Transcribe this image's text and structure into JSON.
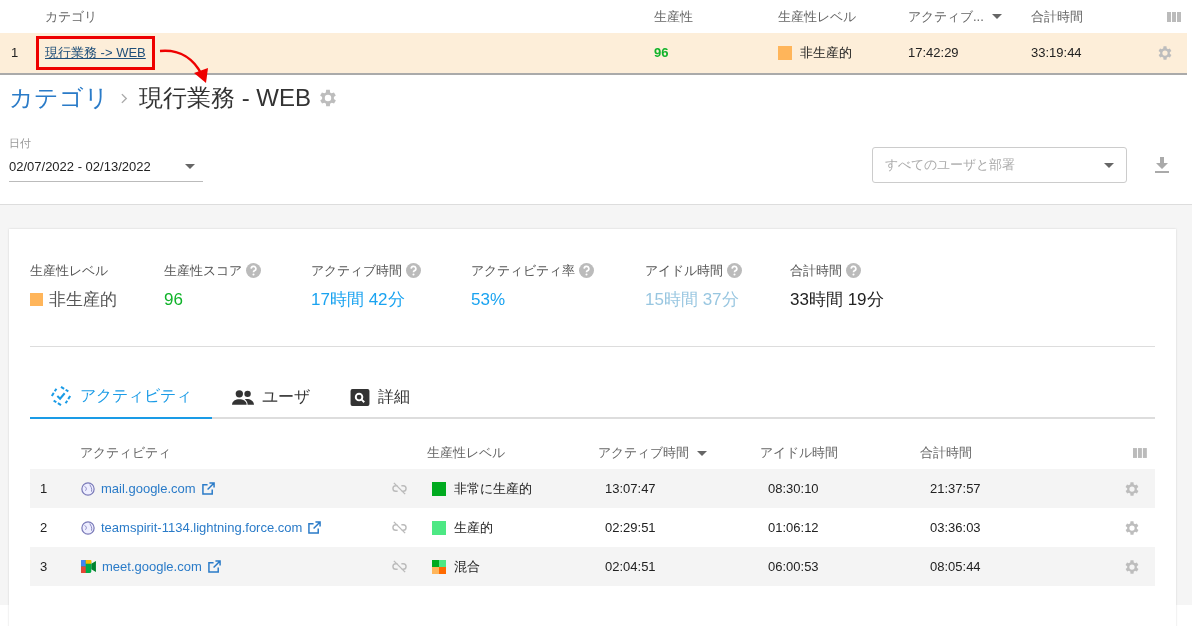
{
  "category_table": {
    "columns": [
      {
        "label": "カテゴリ",
        "sorted": false
      },
      {
        "label": "生産性",
        "sorted": false
      },
      {
        "label": "生産性レベル",
        "sorted": false
      },
      {
        "label": "アクティブ...",
        "sorted": true
      },
      {
        "label": "合計時間",
        "sorted": false
      }
    ],
    "rows": [
      {
        "index": "1",
        "category": "現行業務 -> WEB",
        "highlighted": true,
        "score": "96",
        "level": {
          "label": "非生産的",
          "kind": "solid",
          "color": "#ffb55a"
        },
        "active": "17:42:29",
        "total": "33:19:44"
      }
    ]
  },
  "breadcrumb": {
    "root": "カテゴリ",
    "current": "現行業務 - WEB"
  },
  "date_filter": {
    "label": "日付",
    "value": "02/07/2022 - 02/13/2022"
  },
  "user_filter": {
    "placeholder": "すべてのユーザと部署"
  },
  "stats": [
    {
      "label": "生産性レベル",
      "value": "非生産的",
      "kind": "level",
      "color": "#ffb55a",
      "help": false
    },
    {
      "label": "生産性スコア",
      "value": "96",
      "kind": "score",
      "help": true
    },
    {
      "label": "アクティブ時間",
      "value": "17時間 42分",
      "kind": "accent",
      "help": true
    },
    {
      "label": "アクティビティ率",
      "value": "53%",
      "kind": "accent",
      "help": true
    },
    {
      "label": "アイドル時間",
      "value": "15時間 37分",
      "kind": "faded",
      "help": true
    },
    {
      "label": "合計時間",
      "value": "33時間 19分",
      "kind": "plain",
      "help": true
    }
  ],
  "tabs": [
    {
      "label": "アクティビティ",
      "kind": "activity",
      "selected": true
    },
    {
      "label": "ユーザ",
      "kind": "users",
      "selected": false
    },
    {
      "label": "詳細",
      "kind": "details",
      "selected": false
    }
  ],
  "activity_table": {
    "columns": [
      {
        "label": "アクティビティ",
        "sorted": false
      },
      {
        "label": "生産性レベル",
        "sorted": false
      },
      {
        "label": "アクティブ時間",
        "sorted": true
      },
      {
        "label": "アイドル時間",
        "sorted": false
      },
      {
        "label": "合計時間",
        "sorted": false
      }
    ],
    "rows": [
      {
        "index": "1",
        "name": "mail.google.com",
        "kind": "globe",
        "level": {
          "label": "非常に生産的",
          "kind": "solid",
          "color": "#00aa1f"
        },
        "active": "13:07:47",
        "idle": "08:30:10",
        "total": "21:37:57"
      },
      {
        "index": "2",
        "name": "teamspirit-1134.lightning.force.com",
        "kind": "globe",
        "level": {
          "label": "生産的",
          "kind": "solid",
          "color": "#4de884"
        },
        "active": "02:29:51",
        "idle": "01:06:12",
        "total": "03:36:03"
      },
      {
        "index": "3",
        "name": "meet.google.com",
        "kind": "meet",
        "level": {
          "label": "混合",
          "kind": "mixed"
        },
        "active": "02:04:51",
        "idle": "06:00:53",
        "total": "08:05:44"
      }
    ]
  }
}
